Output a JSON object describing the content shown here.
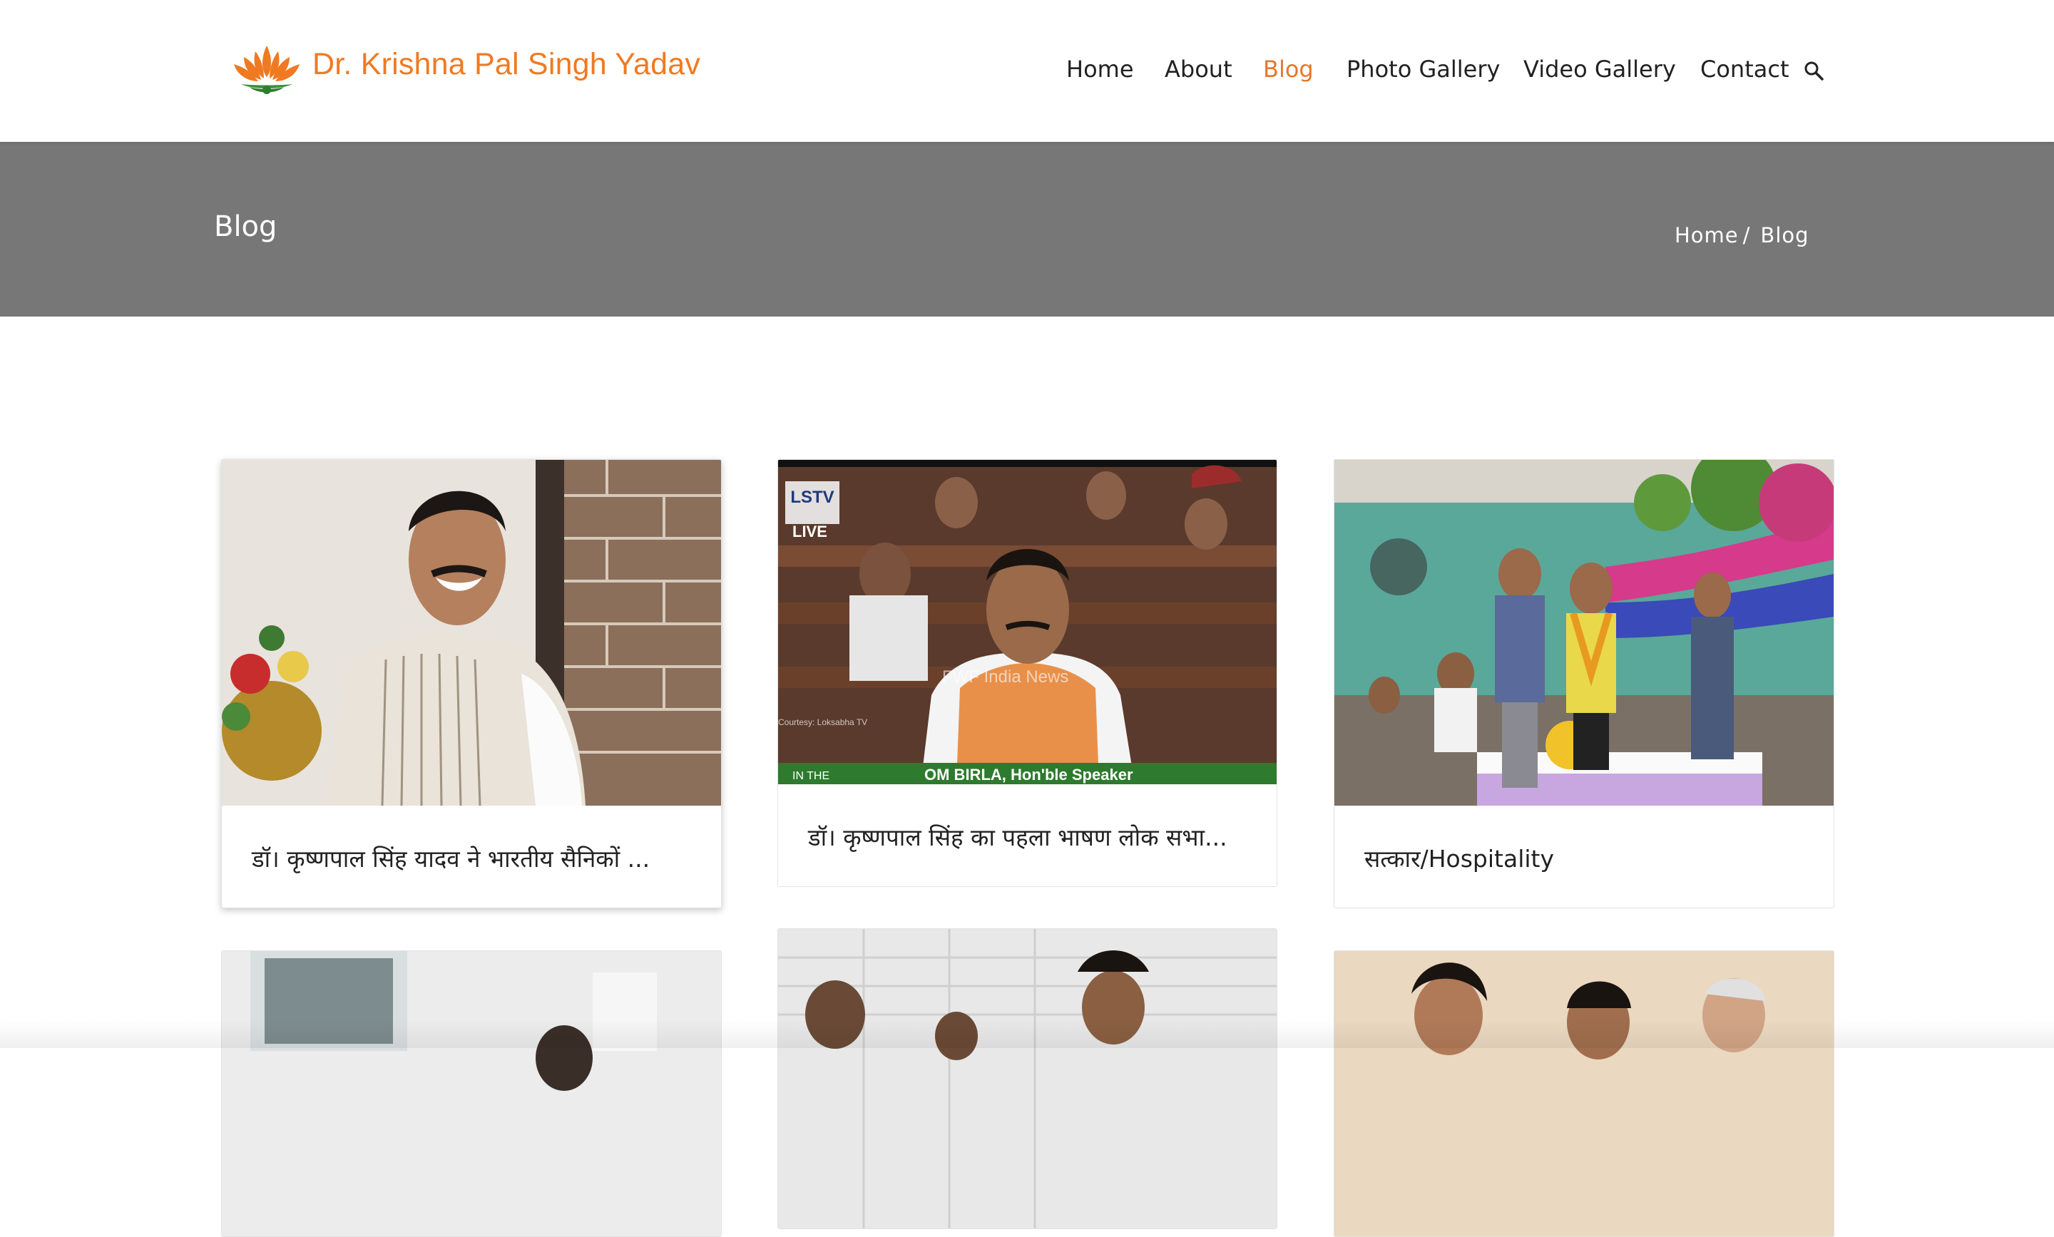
{
  "header": {
    "site_title": "Dr. Krishna Pal Singh Yadav",
    "logo_icon": "lotus-icon",
    "nav": [
      {
        "label": "Home",
        "active": false
      },
      {
        "label": "About",
        "active": false
      },
      {
        "label": "Blog",
        "active": true
      },
      {
        "label": "Photo Gallery",
        "active": false
      },
      {
        "label": "Video Gallery",
        "active": false
      },
      {
        "label": "Contact",
        "active": false
      }
    ],
    "search_icon": "search-icon"
  },
  "banner": {
    "title": "Blog",
    "breadcrumb": {
      "home": "Home",
      "separator": "/",
      "current": "Blog"
    }
  },
  "posts": [
    {
      "caption": "डॉ। कृष्णपाल सिंह यादव ने भारतीय सैनिकों ..."
    },
    {
      "caption": "डॉ। कृष्णपाल सिंह का पहला भाषण लोक सभा...",
      "overlay_top": "LSTV",
      "overlay_live": "LIVE",
      "overlay_watermark": "FWF India News",
      "overlay_ticker": "OM BIRLA, Hon'ble Speaker",
      "overlay_courtesy": "Courtesy: Loksabha TV",
      "overlay_bug": "IN THE"
    },
    {
      "caption": "सत्कार/Hospitality"
    },
    {
      "caption": ""
    },
    {
      "caption": ""
    },
    {
      "caption": ""
    }
  ],
  "colors": {
    "accent": "#f07a22",
    "active_nav": "#e8772a",
    "banner_bg": "#777777"
  }
}
